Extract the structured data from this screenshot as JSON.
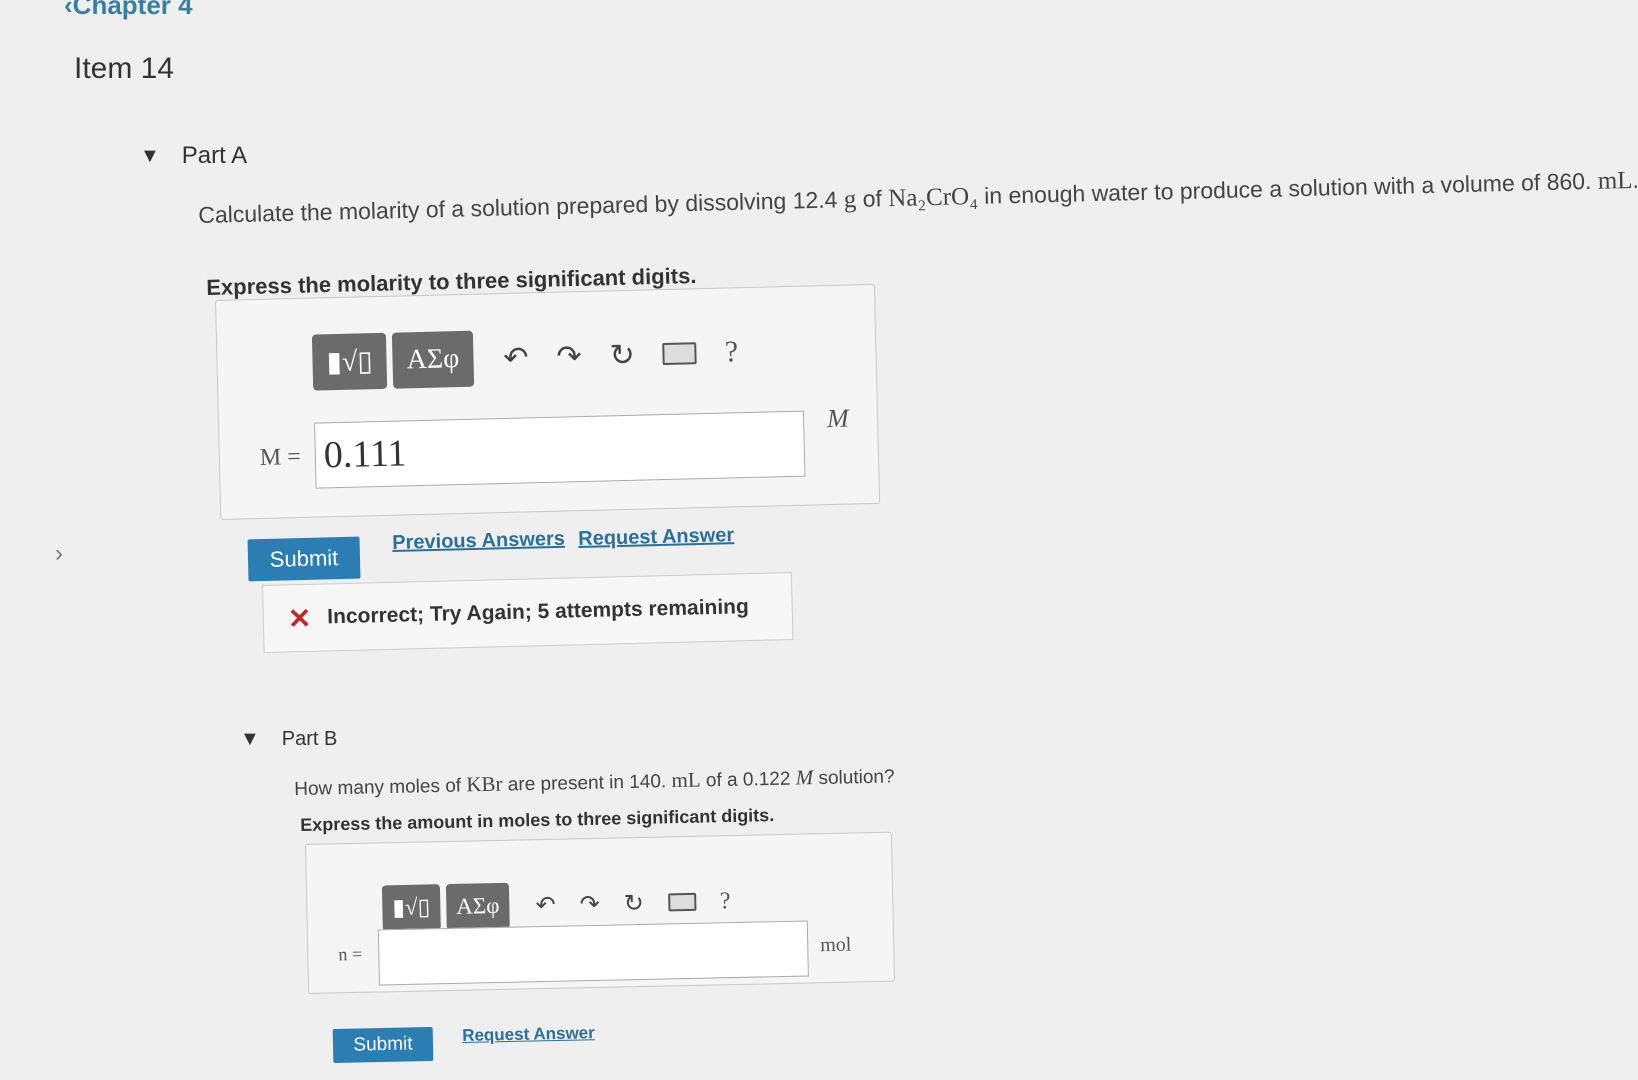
{
  "nav": {
    "back_label": "Chapter 4"
  },
  "item": {
    "title": "Item 14"
  },
  "part_a": {
    "header": "Part A",
    "question_prefix": "Calculate the molarity of a solution prepared by dissolving 12.4",
    "question_unit_g": "g",
    "question_of": " of ",
    "question_compound": "Na₂CrO₄",
    "question_suffix": " in enough water to produce a solution with a volume of 860.",
    "question_unit_ml": "mL",
    "question_end": ".",
    "instruction": "Express the molarity to three significant digits.",
    "toolbar": {
      "templates_label": "▮√▯",
      "greek_label": "ΑΣφ",
      "undo_icon": "↶",
      "redo_icon": "↷",
      "reset_icon": "↻",
      "help_label": "?"
    },
    "eq_label": "M =",
    "answer_value": "0.111",
    "unit": "M",
    "submit_label": "Submit",
    "previous_answers_label": "Previous Answers",
    "request_answer_label": "Request Answer",
    "feedback_text": "Incorrect; Try Again; 5 attempts remaining"
  },
  "part_b": {
    "header": "Part B",
    "question_prefix": "How many moles of ",
    "question_compound": "KBr",
    "question_mid": " are present in 140.",
    "question_unit_ml": "mL",
    "question_mid2": " of a 0.122",
    "question_unit_m": "M",
    "question_end": " solution?",
    "instruction": "Express the amount in moles to three significant digits.",
    "toolbar": {
      "templates_label": "▮√▯",
      "greek_label": "ΑΣφ",
      "undo_icon": "↶",
      "redo_icon": "↷",
      "reset_icon": "↻",
      "help_label": "?"
    },
    "eq_label": "n =",
    "answer_value": "",
    "unit": "mol",
    "submit_label": "Submit",
    "request_answer_label": "Request Answer"
  },
  "colors": {
    "accent": "#2c7db1",
    "link": "#2c6f99",
    "error": "#c0282d",
    "toolbar_button": "#6b6b6b"
  }
}
